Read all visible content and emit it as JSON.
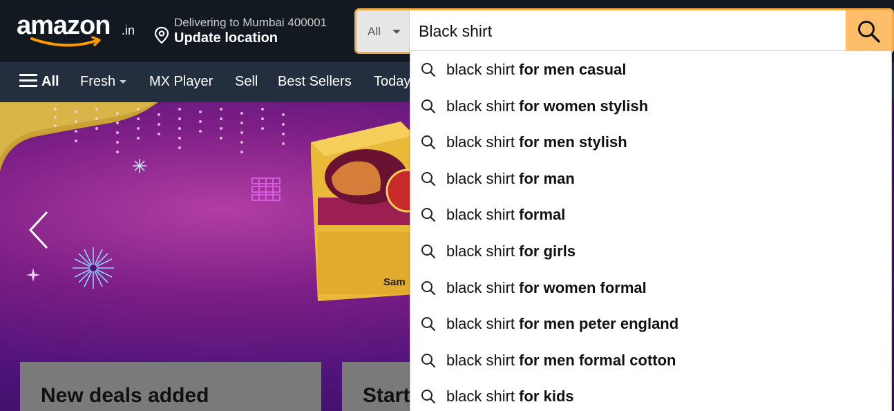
{
  "header": {
    "logo_text": "amazon",
    "logo_suffix": ".in",
    "deliver_line1": "Delivering to Mumbai 400001",
    "deliver_line2": "Update location"
  },
  "search": {
    "category": "All",
    "query": "Black shirt"
  },
  "nav": {
    "all": "All",
    "items": [
      "Fresh",
      "MX Player",
      "Sell",
      "Best Sellers",
      "Today"
    ]
  },
  "hero": {
    "partial_text": "Sam",
    "card1_title": "New deals added",
    "card2_title": "Start"
  },
  "suggestions": [
    {
      "prefix": "black shirt",
      "rest": "for men casual"
    },
    {
      "prefix": "black shirt",
      "rest": "for women stylish"
    },
    {
      "prefix": "black shirt",
      "rest": "for men stylish"
    },
    {
      "prefix": "black shirt",
      "rest": "for man"
    },
    {
      "prefix": "black shirt",
      "rest": "formal"
    },
    {
      "prefix": "black shirt",
      "rest": "for girls"
    },
    {
      "prefix": "black shirt",
      "rest": "for women formal"
    },
    {
      "prefix": "black shirt",
      "rest": "for men peter england"
    },
    {
      "prefix": "black shirt",
      "rest": "for men formal cotton"
    },
    {
      "prefix": "black shirt",
      "rest": "for kids"
    }
  ],
  "colors": {
    "header_bg": "#131921",
    "nav_bg": "#232f3e",
    "search_accent": "#febd69",
    "logo_smile": "#ff9900"
  }
}
